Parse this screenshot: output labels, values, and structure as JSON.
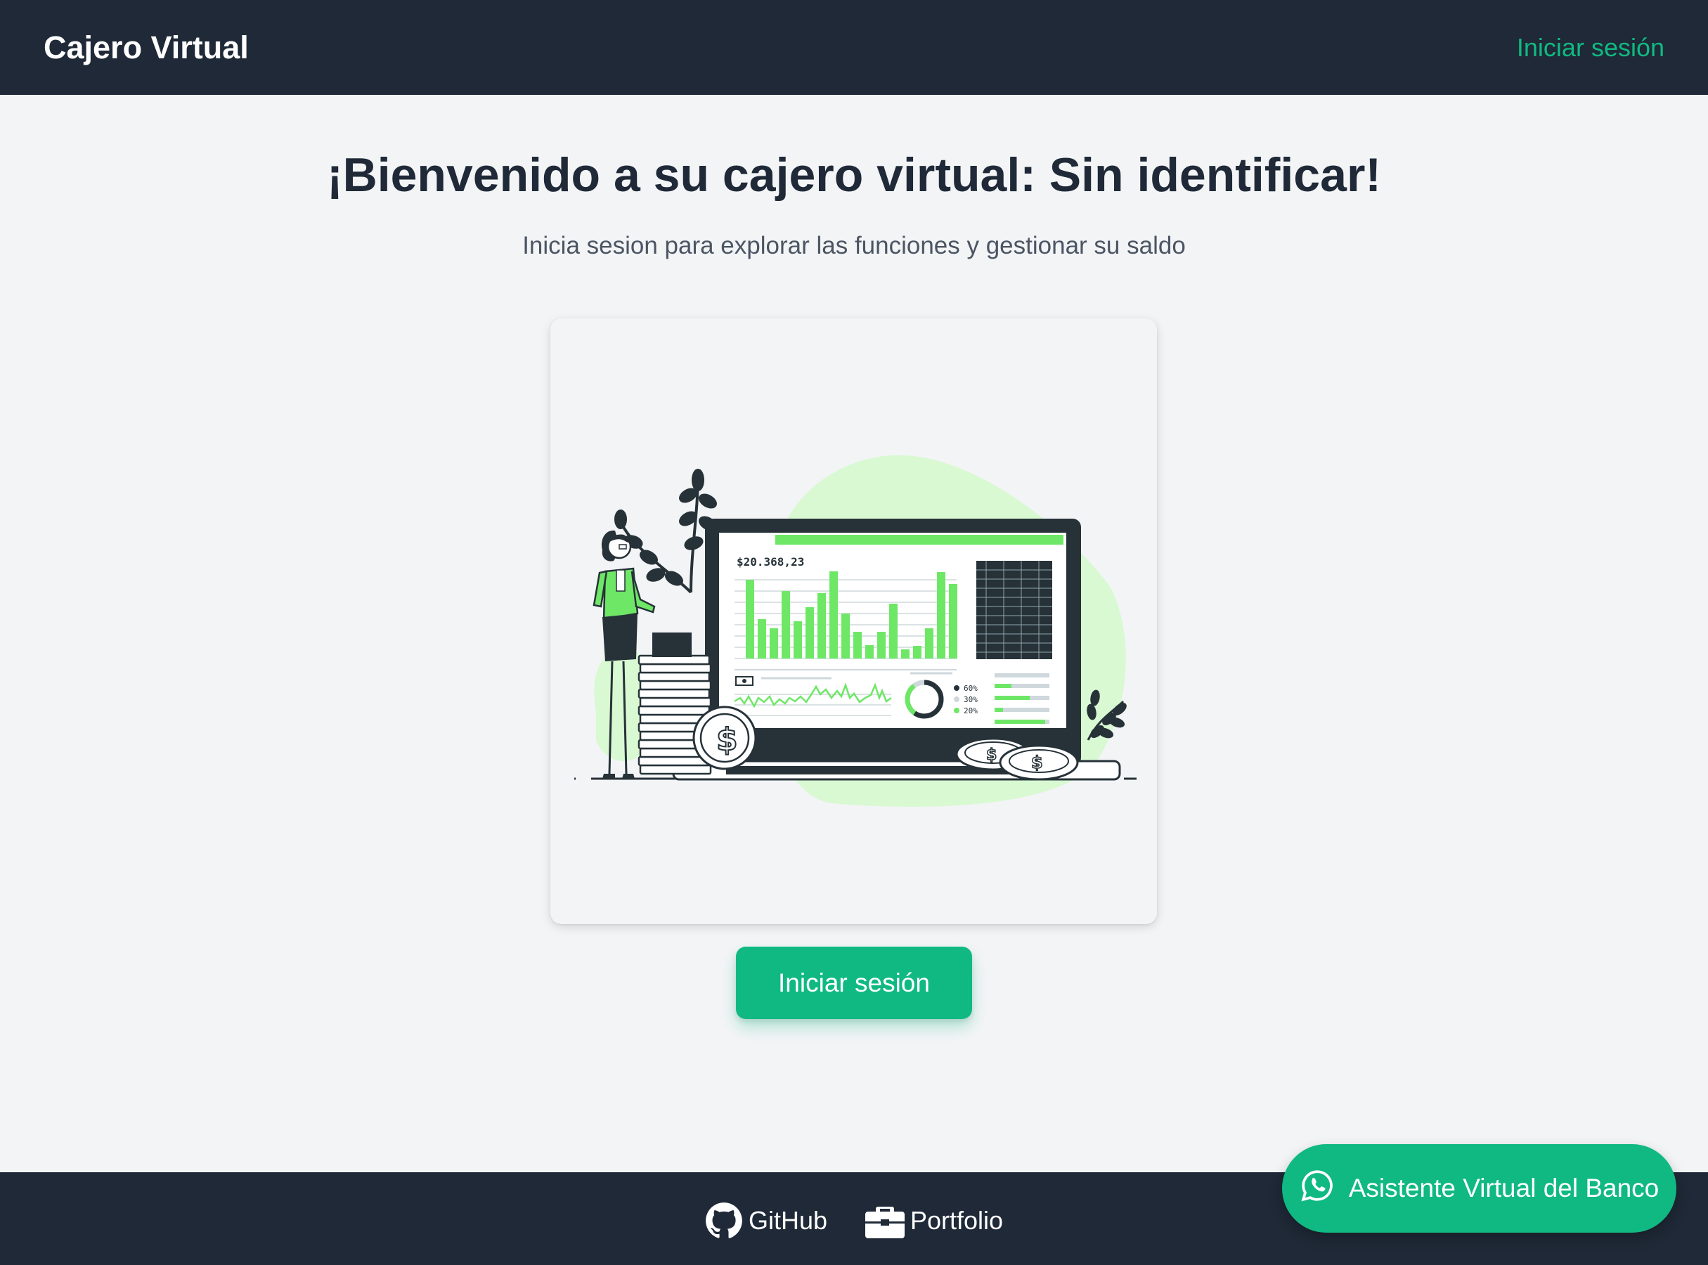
{
  "header": {
    "brand": "Cajero Virtual",
    "login_link": "Iniciar sesión"
  },
  "main": {
    "title": "¡Bienvenido a su cajero virtual: Sin identificar!",
    "subtitle": "Inicia sesion para explorar las funciones y gestionar su saldo",
    "illustration": {
      "balance_label": "$20.368,23",
      "donut_legend": [
        "60%",
        "30%",
        "20%"
      ]
    },
    "login_button": "Iniciar sesión"
  },
  "footer": {
    "links": [
      {
        "label": "GitHub",
        "icon": "github-icon"
      },
      {
        "label": "Portfolio",
        "icon": "briefcase-icon"
      }
    ]
  },
  "assistant": {
    "label": "Asistente Virtual del Banco",
    "icon": "whatsapp-icon"
  },
  "colors": {
    "dark": "#1f2937",
    "accent": "#10b981",
    "illustration_green": "#6ee766",
    "illustration_light_green": "#d8f9d2",
    "background": "#f3f4f6"
  }
}
